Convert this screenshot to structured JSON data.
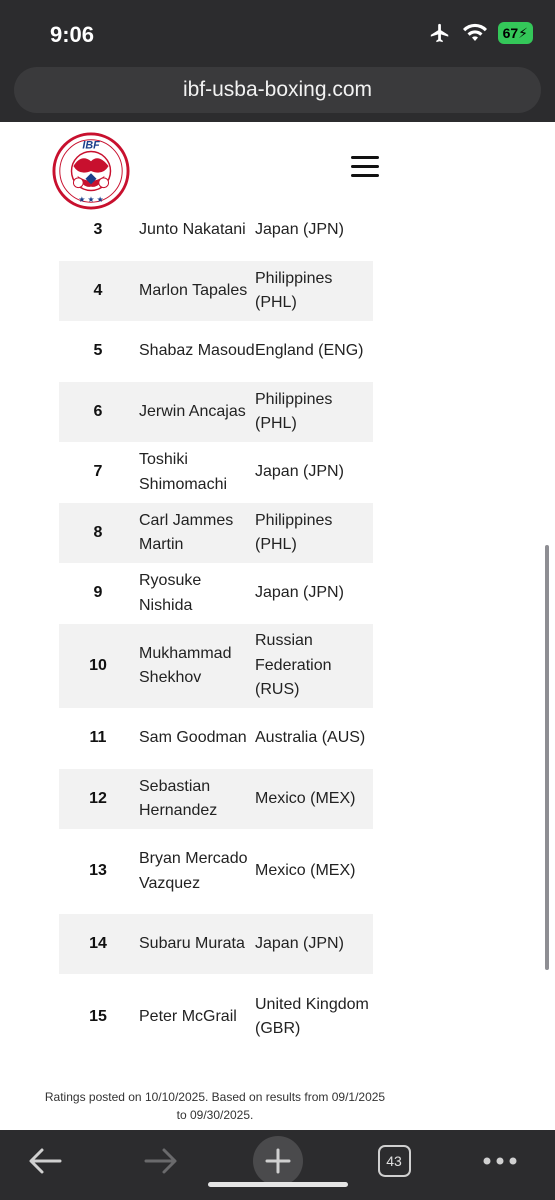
{
  "status": {
    "time": "9:06",
    "battery": "67"
  },
  "browser": {
    "url": "ibf-usba-boxing.com",
    "tab_count": "43"
  },
  "site": {
    "logo_text": "IBF"
  },
  "ratings": {
    "partial_row": {
      "rank": "3",
      "name": "Junto Nakatani",
      "country": "Japan (JPN)"
    },
    "rows": [
      {
        "rank": "4",
        "name": "Marlon Tapales",
        "country": "Philippines (PHL)"
      },
      {
        "rank": "5",
        "name": "Shabaz Masoud",
        "country": "England (ENG)"
      },
      {
        "rank": "6",
        "name": "Jerwin Ancajas",
        "country": "Philippines (PHL)"
      },
      {
        "rank": "7",
        "name": "Toshiki Shimomachi",
        "country": "Japan (JPN)"
      },
      {
        "rank": "8",
        "name": "Carl Jammes Martin",
        "country": "Philippines (PHL)"
      },
      {
        "rank": "9",
        "name": "Ryosuke Nishida",
        "country": "Japan (JPN)"
      },
      {
        "rank": "10",
        "name": "Mukhammad Shekhov",
        "country": "Russian Federation (RUS)"
      },
      {
        "rank": "11",
        "name": "Sam Goodman",
        "country": "Australia (AUS)"
      },
      {
        "rank": "12",
        "name": "Sebastian Hernandez",
        "country": "Mexico (MEX)"
      },
      {
        "rank": "13",
        "name": "Bryan Mercado Vazquez",
        "country": "Mexico (MEX)"
      },
      {
        "rank": "14",
        "name": "Subaru Murata",
        "country": "Japan (JPN)"
      },
      {
        "rank": "15",
        "name": "Peter McGrail",
        "country": "United Kingdom (GBR)"
      }
    ]
  },
  "footnote": "Ratings posted on 10/10/2025. Based on results from 09/1/2025 to 09/30/2025.",
  "toolbar": {
    "icons": [
      "back-arrow-icon",
      "forward-arrow-icon",
      "new-tab-plus-icon",
      "tabs-icon",
      "more-icon"
    ]
  }
}
